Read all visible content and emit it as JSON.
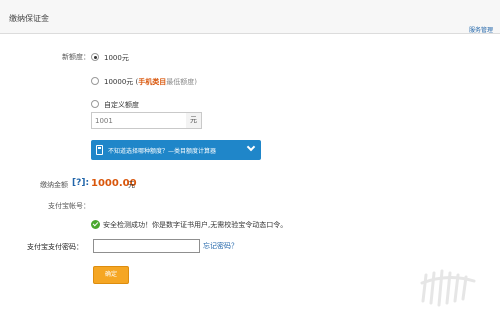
{
  "header": {
    "title": "缴纳保证金",
    "service_link": "服务管理"
  },
  "form": {
    "new_amount_label": "新额度：",
    "options": [
      {
        "text": "1000元",
        "checked": true
      },
      {
        "text": "10000元 (",
        "highlight": "手机类目",
        "suffix": "最低额度)",
        "checked": false
      },
      {
        "text": "自定义额度",
        "checked": false
      }
    ],
    "custom_amount_value": "1001",
    "custom_amount_unit": "元",
    "calculator_text": "不知道选择哪种额度？—类目额度计算器"
  },
  "payment": {
    "label": "缴纳金额",
    "help": "[?]:",
    "amount": "1000.00",
    "unit": "元"
  },
  "alipay": {
    "account_label": "支付宝帐号：",
    "success_message": "安全检测成功！你是数字证书用户,无需校验宝令动态口令。",
    "password_label": "支付宝支付密码：",
    "password_value": "",
    "forgot_link": "忘记密码？"
  },
  "actions": {
    "confirm_label": "确定"
  },
  "colors": {
    "accent_blue": "#1f86c9",
    "amount_orange": "#d9560b",
    "button_orange": "#f5a623",
    "success_green": "#4aa72e"
  }
}
